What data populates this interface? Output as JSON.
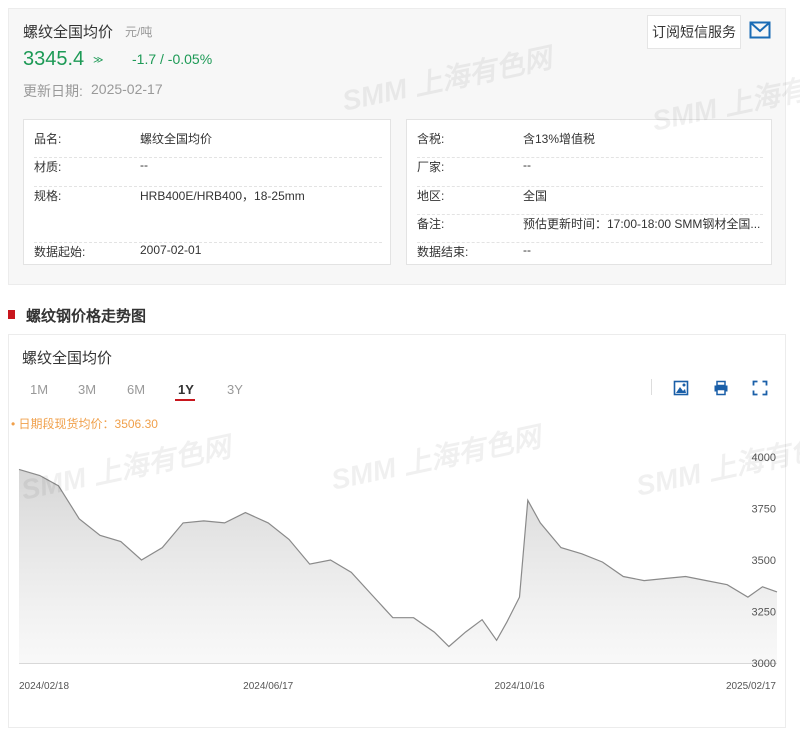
{
  "header": {
    "title": "螺纹全国均价",
    "unit": "元/吨",
    "price": "3345.4",
    "arrow": "≫",
    "change": "-1.7  /  -0.05%",
    "update_label": "更新日期:",
    "update_date": "2025-02-17",
    "subscribe_label": "订阅短信服务"
  },
  "info_left": [
    {
      "k": "品名:",
      "v": "螺纹全国均价"
    },
    {
      "k": "材质:",
      "v": "--"
    },
    {
      "k": "规格:",
      "v": "HRB400E/HRB400，18-25mm"
    },
    {
      "k": "数据起始:",
      "v": "2007-02-01"
    }
  ],
  "info_right": [
    {
      "k": "含税:",
      "v": "含13%增值税"
    },
    {
      "k": "厂家:",
      "v": "--"
    },
    {
      "k": "地区:",
      "v": "全国"
    },
    {
      "k": "备注:",
      "v": "预估更新时间：17:00-18:00 SMM钢材全国..."
    },
    {
      "k": "数据结束:",
      "v": "--"
    }
  ],
  "section": {
    "title": "螺纹钢价格走势图"
  },
  "chart_panel": {
    "title": "螺纹全国均价",
    "ranges": [
      "1M",
      "3M",
      "6M",
      "1Y",
      "3Y"
    ],
    "active_range": "1Y",
    "avg_label": "• 日期段现货均价：3506.30",
    "watermark": "SMM 上海有色网"
  },
  "colors": {
    "up_green": "#1d9a56",
    "accent_red": "#c8161d",
    "line_gray": "#8a8a8a",
    "avg_orange": "#f0a04b"
  },
  "chart_data": {
    "type": "area",
    "title": "螺纹全国均价",
    "x_tick_labels": [
      "2024/02/18",
      "2024/06/17",
      "2024/10/16",
      "2025/02/17"
    ],
    "y_tick_labels": [
      "4000",
      "3750",
      "3500",
      "3250",
      "3000"
    ],
    "ylim": [
      3000,
      4000
    ],
    "grid": false,
    "series": [
      {
        "values": [
          {
            "x": "2024-02-18",
            "y": 3940
          },
          {
            "x": "2024-02-28",
            "y": 3910
          },
          {
            "x": "2024-03-08",
            "y": 3860
          },
          {
            "x": "2024-03-18",
            "y": 3700
          },
          {
            "x": "2024-03-28",
            "y": 3620
          },
          {
            "x": "2024-04-07",
            "y": 3590
          },
          {
            "x": "2024-04-17",
            "y": 3500
          },
          {
            "x": "2024-04-27",
            "y": 3560
          },
          {
            "x": "2024-05-07",
            "y": 3680
          },
          {
            "x": "2024-05-17",
            "y": 3690
          },
          {
            "x": "2024-05-27",
            "y": 3680
          },
          {
            "x": "2024-06-06",
            "y": 3730
          },
          {
            "x": "2024-06-17",
            "y": 3680
          },
          {
            "x": "2024-06-27",
            "y": 3600
          },
          {
            "x": "2024-07-07",
            "y": 3480
          },
          {
            "x": "2024-07-17",
            "y": 3500
          },
          {
            "x": "2024-07-27",
            "y": 3440
          },
          {
            "x": "2024-08-06",
            "y": 3330
          },
          {
            "x": "2024-08-16",
            "y": 3220
          },
          {
            "x": "2024-08-26",
            "y": 3220
          },
          {
            "x": "2024-09-05",
            "y": 3150
          },
          {
            "x": "2024-09-12",
            "y": 3080
          },
          {
            "x": "2024-09-20",
            "y": 3150
          },
          {
            "x": "2024-09-28",
            "y": 3210
          },
          {
            "x": "2024-10-05",
            "y": 3110
          },
          {
            "x": "2024-10-10",
            "y": 3200
          },
          {
            "x": "2024-10-16",
            "y": 3320
          },
          {
            "x": "2024-10-20",
            "y": 3790
          },
          {
            "x": "2024-10-26",
            "y": 3680
          },
          {
            "x": "2024-11-05",
            "y": 3560
          },
          {
            "x": "2024-11-15",
            "y": 3530
          },
          {
            "x": "2024-11-25",
            "y": 3490
          },
          {
            "x": "2024-12-05",
            "y": 3420
          },
          {
            "x": "2024-12-15",
            "y": 3400
          },
          {
            "x": "2024-12-25",
            "y": 3410
          },
          {
            "x": "2025-01-04",
            "y": 3420
          },
          {
            "x": "2025-01-14",
            "y": 3400
          },
          {
            "x": "2025-01-24",
            "y": 3380
          },
          {
            "x": "2025-02-03",
            "y": 3320
          },
          {
            "x": "2025-02-10",
            "y": 3370
          },
          {
            "x": "2025-02-17",
            "y": 3345
          }
        ]
      }
    ]
  }
}
